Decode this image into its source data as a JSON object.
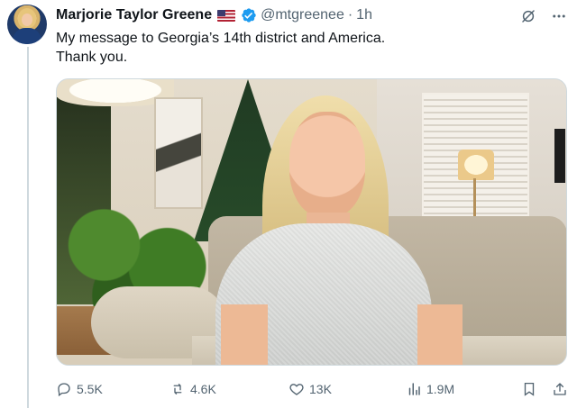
{
  "author": {
    "name": "Marjorie Taylor Greene",
    "handle": "@mtgreenee",
    "separator": "·",
    "time": "1h",
    "flag_icon": "us-flag-icon",
    "verified_icon": "verified-badge-icon"
  },
  "tweet": {
    "text": "My message to Georgia’s 14th district and America.\nThank you."
  },
  "actions": {
    "replies": "5.5K",
    "reposts": "4.6K",
    "likes": "13K",
    "views": "1.9M"
  },
  "icons": {
    "grok": "grok-icon",
    "more": "more-icon",
    "reply": "reply-icon",
    "repost": "repost-icon",
    "like": "heart-icon",
    "views": "views-icon",
    "bookmark": "bookmark-icon",
    "share": "share-icon"
  },
  "colors": {
    "text": "#0f1419",
    "secondary": "#536471",
    "verified": "#1d9bf0",
    "border": "#cfd9de"
  }
}
